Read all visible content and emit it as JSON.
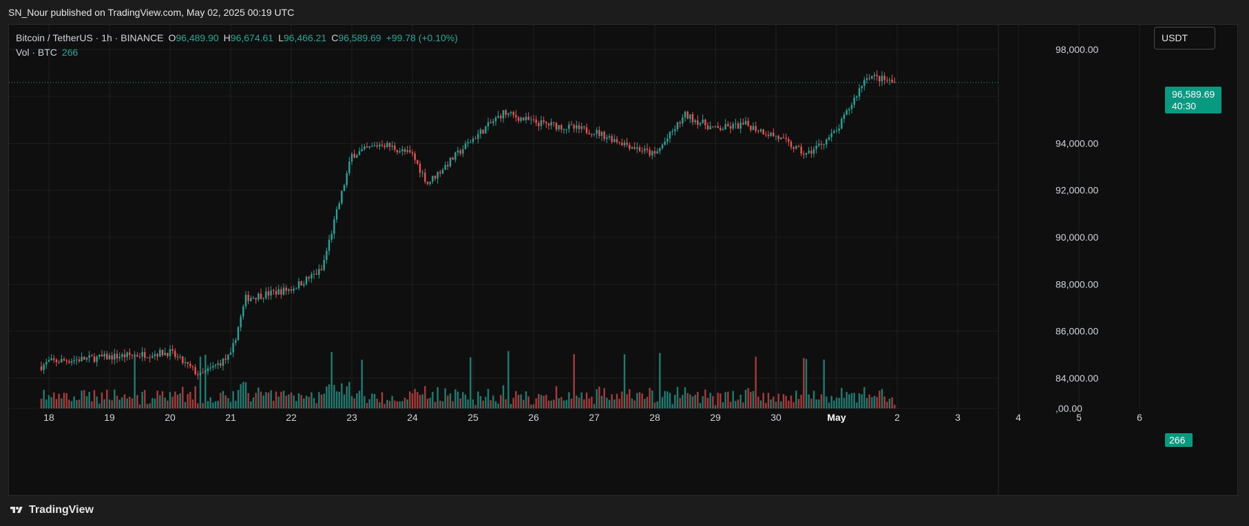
{
  "publisher_line": "SN_Nour published on TradingView.com, May 02, 2025 00:19 UTC",
  "symbol": {
    "title": "Bitcoin / TetherUS · 1h · BINANCE",
    "o_label": "O",
    "o": "96,489.90",
    "h_label": "H",
    "h": "96,674.61",
    "l_label": "L",
    "l": "96,466.21",
    "c_label": "C",
    "c": "96,589.69",
    "change": "+99.78 (+0.10%)"
  },
  "volume_label": {
    "name": "Vol · BTC",
    "value": "266"
  },
  "currency_button": "USDT",
  "last_price_tag": {
    "price": "96,589.69",
    "countdown": "40:30"
  },
  "volume_tag": "266",
  "footer": {
    "brand": "TradingView"
  },
  "colors": {
    "up": "#26a69a",
    "down": "#ef5350",
    "up_vol": "#1e7d73",
    "down_vol": "#a83c3a",
    "background": "#0f0f0f",
    "grid": "#1f1f1f",
    "tag": "#089981"
  },
  "chart_data": {
    "type": "candlestick",
    "interval": "1h",
    "ylim": [
      82650,
      99050
    ],
    "y_ticks": [
      "98,000.00",
      "94,000.00",
      "92,000.00",
      "90,000.00",
      "88,000.00",
      "86,000.00",
      "84,000.00",
      ",00.00"
    ],
    "x_tick_labels": [
      "18",
      "19",
      "20",
      "21",
      "22",
      "23",
      "24",
      "25",
      "26",
      "27",
      "28",
      "29",
      "30",
      "May",
      "2",
      "3",
      "4",
      "5",
      "6"
    ],
    "last_price": 96589.69,
    "daily_closes": [
      {
        "date": "Apr 17 21:00",
        "close": 84500
      },
      {
        "date": "Apr 18",
        "close": 84700
      },
      {
        "date": "Apr 19",
        "close": 84900
      },
      {
        "date": "Apr 20",
        "close": 85100
      },
      {
        "date": "Apr 20 12:00",
        "close": 84100
      },
      {
        "date": "Apr 21",
        "close": 84950
      },
      {
        "date": "Apr 21 06:00",
        "close": 87400
      },
      {
        "date": "Apr 22",
        "close": 87800
      },
      {
        "date": "Apr 22 12:00",
        "close": 88600
      },
      {
        "date": "Apr 23",
        "close": 93500
      },
      {
        "date": "Apr 23 12:00",
        "close": 94000
      },
      {
        "date": "Apr 24",
        "close": 93500
      },
      {
        "date": "Apr 24 06:00",
        "close": 92300
      },
      {
        "date": "Apr 25",
        "close": 94200
      },
      {
        "date": "Apr 25 12:00",
        "close": 95300
      },
      {
        "date": "Apr 26",
        "close": 94900
      },
      {
        "date": "Apr 27",
        "close": 94500
      },
      {
        "date": "Apr 28",
        "close": 93500
      },
      {
        "date": "Apr 28 12:00",
        "close": 95200
      },
      {
        "date": "Apr 29",
        "close": 94600
      },
      {
        "date": "Apr 29 12:00",
        "close": 94800
      },
      {
        "date": "Apr 30",
        "close": 94300
      },
      {
        "date": "Apr 30 12:00",
        "close": 93500
      },
      {
        "date": "May 1",
        "close": 94500
      },
      {
        "date": "May 1 12:00",
        "close": 96900
      },
      {
        "date": "May 1 23:00",
        "close": 96589.69
      }
    ]
  }
}
